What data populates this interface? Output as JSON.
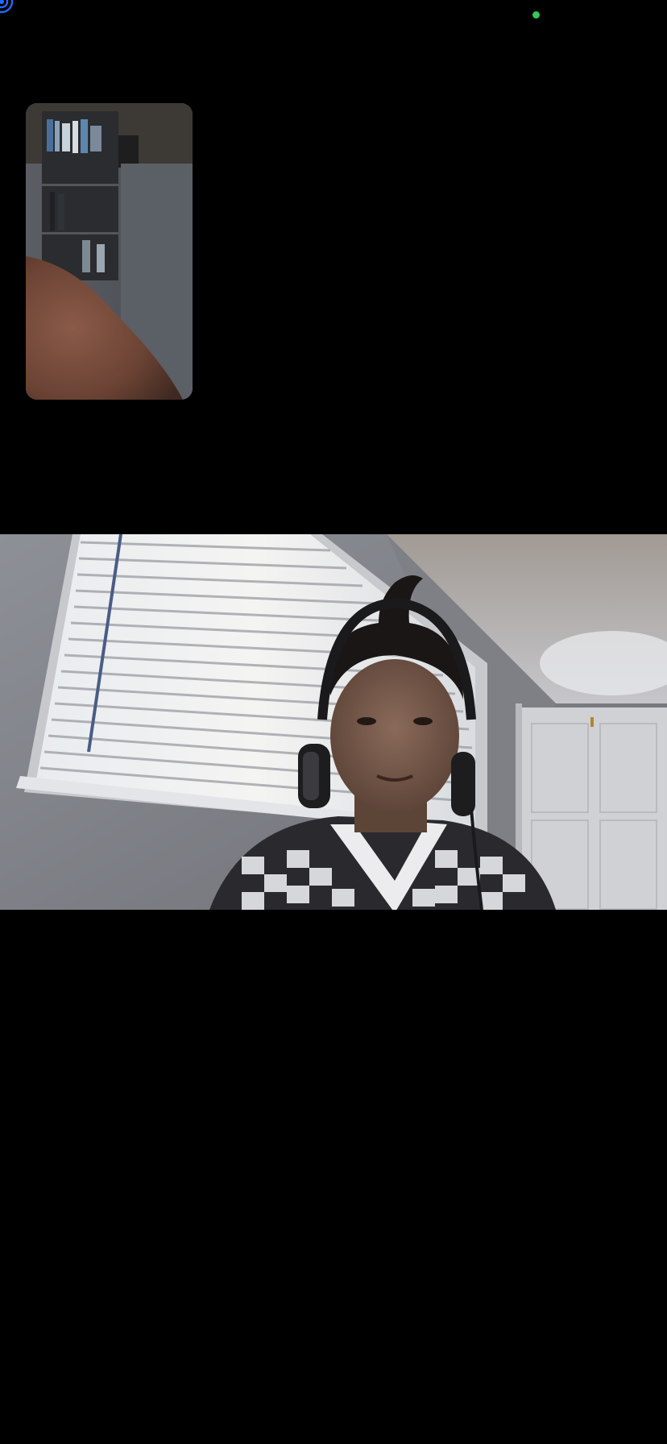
{
  "call": {
    "type": "video-call",
    "camera_indicator_color": "#34c759",
    "accent_color": "#1e6cff"
  },
  "self_view": {
    "label": "",
    "icon": "self-camera-preview"
  },
  "remote_view": {
    "label": "",
    "icon": "remote-participant-video"
  }
}
